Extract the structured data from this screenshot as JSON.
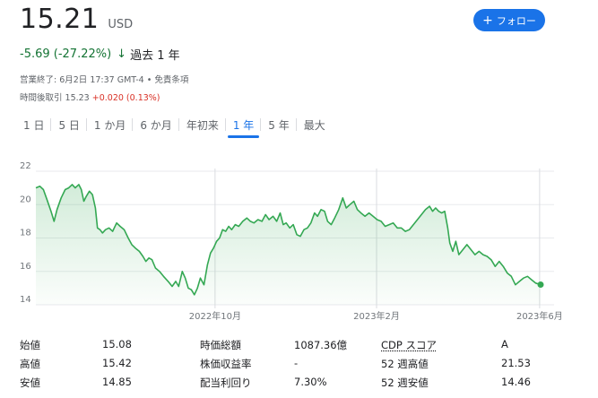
{
  "quote": {
    "price": "15.21",
    "currency": "USD",
    "change": "-5.69 (-27.22%)",
    "change_arrow": "↓",
    "period": "過去 1 年",
    "market_status": "営業終了: 6月2日 17:37 GMT-4 • 免責条項",
    "after_hours_label": "時間後取引 15.23",
    "after_hours_change": "+0.020 (0.13%)"
  },
  "follow_button": {
    "label": "フォロー",
    "icon": "plus-icon"
  },
  "tabs": [
    {
      "label": "1 日",
      "active": false
    },
    {
      "label": "5 日",
      "active": false
    },
    {
      "label": "1 か月",
      "active": false
    },
    {
      "label": "6 か月",
      "active": false
    },
    {
      "label": "年初来",
      "active": false
    },
    {
      "label": "1 年",
      "active": true
    },
    {
      "label": "5 年",
      "active": false
    },
    {
      "label": "最大",
      "active": false
    }
  ],
  "chart_data": {
    "type": "area",
    "y_ticks": [
      "22",
      "20",
      "18",
      "16",
      "14"
    ],
    "ylim": [
      14,
      22
    ],
    "x_ticks": [
      {
        "label": "2022年10月",
        "t": 0.355
      },
      {
        "label": "2023年2月",
        "t": 0.675
      },
      {
        "label": "2023年6月",
        "t": 0.998
      }
    ],
    "grid": true,
    "line_color": "#34a853",
    "points": [
      [
        0.0,
        21.0
      ],
      [
        0.008,
        21.1
      ],
      [
        0.015,
        20.9
      ],
      [
        0.022,
        20.3
      ],
      [
        0.03,
        19.6
      ],
      [
        0.036,
        19.0
      ],
      [
        0.042,
        19.7
      ],
      [
        0.05,
        20.4
      ],
      [
        0.058,
        20.9
      ],
      [
        0.065,
        21.0
      ],
      [
        0.072,
        21.2
      ],
      [
        0.078,
        21.0
      ],
      [
        0.085,
        21.2
      ],
      [
        0.09,
        20.9
      ],
      [
        0.095,
        20.2
      ],
      [
        0.1,
        20.5
      ],
      [
        0.106,
        20.8
      ],
      [
        0.112,
        20.6
      ],
      [
        0.118,
        19.8
      ],
      [
        0.122,
        18.6
      ],
      [
        0.127,
        18.5
      ],
      [
        0.132,
        18.3
      ],
      [
        0.138,
        18.5
      ],
      [
        0.145,
        18.6
      ],
      [
        0.152,
        18.4
      ],
      [
        0.16,
        18.9
      ],
      [
        0.167,
        18.7
      ],
      [
        0.175,
        18.5
      ],
      [
        0.183,
        18.0
      ],
      [
        0.19,
        17.6
      ],
      [
        0.197,
        17.4
      ],
      [
        0.205,
        17.2
      ],
      [
        0.212,
        16.9
      ],
      [
        0.218,
        16.6
      ],
      [
        0.224,
        16.8
      ],
      [
        0.23,
        16.7
      ],
      [
        0.237,
        16.2
      ],
      [
        0.245,
        16.0
      ],
      [
        0.253,
        15.7
      ],
      [
        0.262,
        15.4
      ],
      [
        0.27,
        15.1
      ],
      [
        0.277,
        15.4
      ],
      [
        0.283,
        15.1
      ],
      [
        0.29,
        16.0
      ],
      [
        0.296,
        15.6
      ],
      [
        0.302,
        15.0
      ],
      [
        0.308,
        14.9
      ],
      [
        0.314,
        14.6
      ],
      [
        0.32,
        15.0
      ],
      [
        0.326,
        15.6
      ],
      [
        0.333,
        15.2
      ],
      [
        0.34,
        16.4
      ],
      [
        0.346,
        17.1
      ],
      [
        0.352,
        17.4
      ],
      [
        0.358,
        17.8
      ],
      [
        0.364,
        18.0
      ],
      [
        0.37,
        18.5
      ],
      [
        0.376,
        18.4
      ],
      [
        0.382,
        18.7
      ],
      [
        0.388,
        18.5
      ],
      [
        0.395,
        18.8
      ],
      [
        0.402,
        18.7
      ],
      [
        0.41,
        19.0
      ],
      [
        0.418,
        19.2
      ],
      [
        0.425,
        19.0
      ],
      [
        0.432,
        18.9
      ],
      [
        0.44,
        19.1
      ],
      [
        0.448,
        19.0
      ],
      [
        0.455,
        19.4
      ],
      [
        0.462,
        19.1
      ],
      [
        0.47,
        19.3
      ],
      [
        0.477,
        19.0
      ],
      [
        0.484,
        19.5
      ],
      [
        0.49,
        18.8
      ],
      [
        0.496,
        18.9
      ],
      [
        0.503,
        18.6
      ],
      [
        0.51,
        18.8
      ],
      [
        0.517,
        18.2
      ],
      [
        0.524,
        18.1
      ],
      [
        0.531,
        18.5
      ],
      [
        0.538,
        18.6
      ],
      [
        0.545,
        18.9
      ],
      [
        0.552,
        19.5
      ],
      [
        0.558,
        19.3
      ],
      [
        0.565,
        19.7
      ],
      [
        0.572,
        19.6
      ],
      [
        0.578,
        19.0
      ],
      [
        0.585,
        18.8
      ],
      [
        0.592,
        19.2
      ],
      [
        0.6,
        19.7
      ],
      [
        0.608,
        20.4
      ],
      [
        0.615,
        19.8
      ],
      [
        0.622,
        20.0
      ],
      [
        0.63,
        20.2
      ],
      [
        0.637,
        19.7
      ],
      [
        0.644,
        19.5
      ],
      [
        0.652,
        19.3
      ],
      [
        0.66,
        19.5
      ],
      [
        0.668,
        19.3
      ],
      [
        0.676,
        19.1
      ],
      [
        0.684,
        19.0
      ],
      [
        0.692,
        18.7
      ],
      [
        0.7,
        18.8
      ],
      [
        0.708,
        18.9
      ],
      [
        0.716,
        18.6
      ],
      [
        0.724,
        18.6
      ],
      [
        0.732,
        18.4
      ],
      [
        0.74,
        18.5
      ],
      [
        0.748,
        18.8
      ],
      [
        0.756,
        19.1
      ],
      [
        0.764,
        19.4
      ],
      [
        0.772,
        19.7
      ],
      [
        0.78,
        19.9
      ],
      [
        0.786,
        19.6
      ],
      [
        0.792,
        19.8
      ],
      [
        0.798,
        19.6
      ],
      [
        0.804,
        19.5
      ],
      [
        0.81,
        19.6
      ],
      [
        0.816,
        18.6
      ],
      [
        0.82,
        17.7
      ],
      [
        0.826,
        17.2
      ],
      [
        0.832,
        17.8
      ],
      [
        0.838,
        17.0
      ],
      [
        0.846,
        17.3
      ],
      [
        0.854,
        17.6
      ],
      [
        0.862,
        17.3
      ],
      [
        0.87,
        17.0
      ],
      [
        0.878,
        17.2
      ],
      [
        0.886,
        17.0
      ],
      [
        0.894,
        16.9
      ],
      [
        0.902,
        16.7
      ],
      [
        0.91,
        16.3
      ],
      [
        0.918,
        16.6
      ],
      [
        0.926,
        16.3
      ],
      [
        0.934,
        15.9
      ],
      [
        0.942,
        15.7
      ],
      [
        0.95,
        15.2
      ],
      [
        0.958,
        15.4
      ],
      [
        0.966,
        15.6
      ],
      [
        0.974,
        15.7
      ],
      [
        0.982,
        15.5
      ],
      [
        0.99,
        15.3
      ],
      [
        1.0,
        15.21
      ]
    ]
  },
  "stats": {
    "col1": [
      {
        "label": "始値",
        "value": "15.08"
      },
      {
        "label": "高値",
        "value": "15.42"
      },
      {
        "label": "安値",
        "value": "14.85"
      }
    ],
    "col2": [
      {
        "label": "時価総額",
        "value": "1087.36億"
      },
      {
        "label": "株価収益率",
        "value": "-"
      },
      {
        "label": "配当利回り",
        "value": "7.30%"
      }
    ],
    "col3": [
      {
        "label": "CDP スコア",
        "value": "A"
      },
      {
        "label": "52 週高値",
        "value": "21.53"
      },
      {
        "label": "52 週安値",
        "value": "14.46"
      }
    ]
  }
}
